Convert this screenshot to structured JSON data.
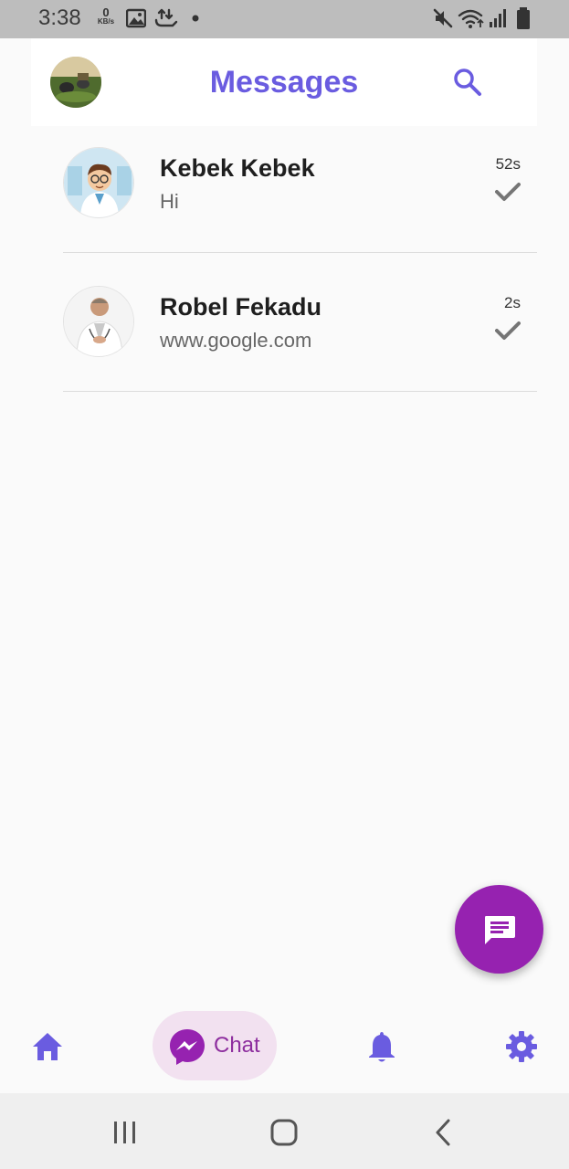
{
  "status_bar": {
    "time": "3:38",
    "net_speed_value": "0",
    "net_speed_unit": "KB/s"
  },
  "header": {
    "title": "Messages",
    "avatar_icon": "profile-photo",
    "search_icon": "search-icon"
  },
  "conversations": [
    {
      "name": "Kebek Kebek",
      "preview": "Hi",
      "time": "52s",
      "status_icon": "check-icon"
    },
    {
      "name": "Robel Fekadu",
      "preview": "www.google.com",
      "time": "2s",
      "status_icon": "check-icon"
    }
  ],
  "fab": {
    "icon": "message-icon"
  },
  "bottom_nav": {
    "items": [
      {
        "icon": "home-icon"
      },
      {
        "label": "Chat",
        "icon": "messenger-icon",
        "active": true
      },
      {
        "icon": "bell-icon"
      },
      {
        "icon": "gear-icon"
      }
    ]
  },
  "colors": {
    "accent": "#6a5ce0",
    "fab": "#9622b0",
    "chat_active_bg": "#f2e1f0",
    "chat_active_text": "#8d2d9e",
    "background": "#fafafa"
  }
}
